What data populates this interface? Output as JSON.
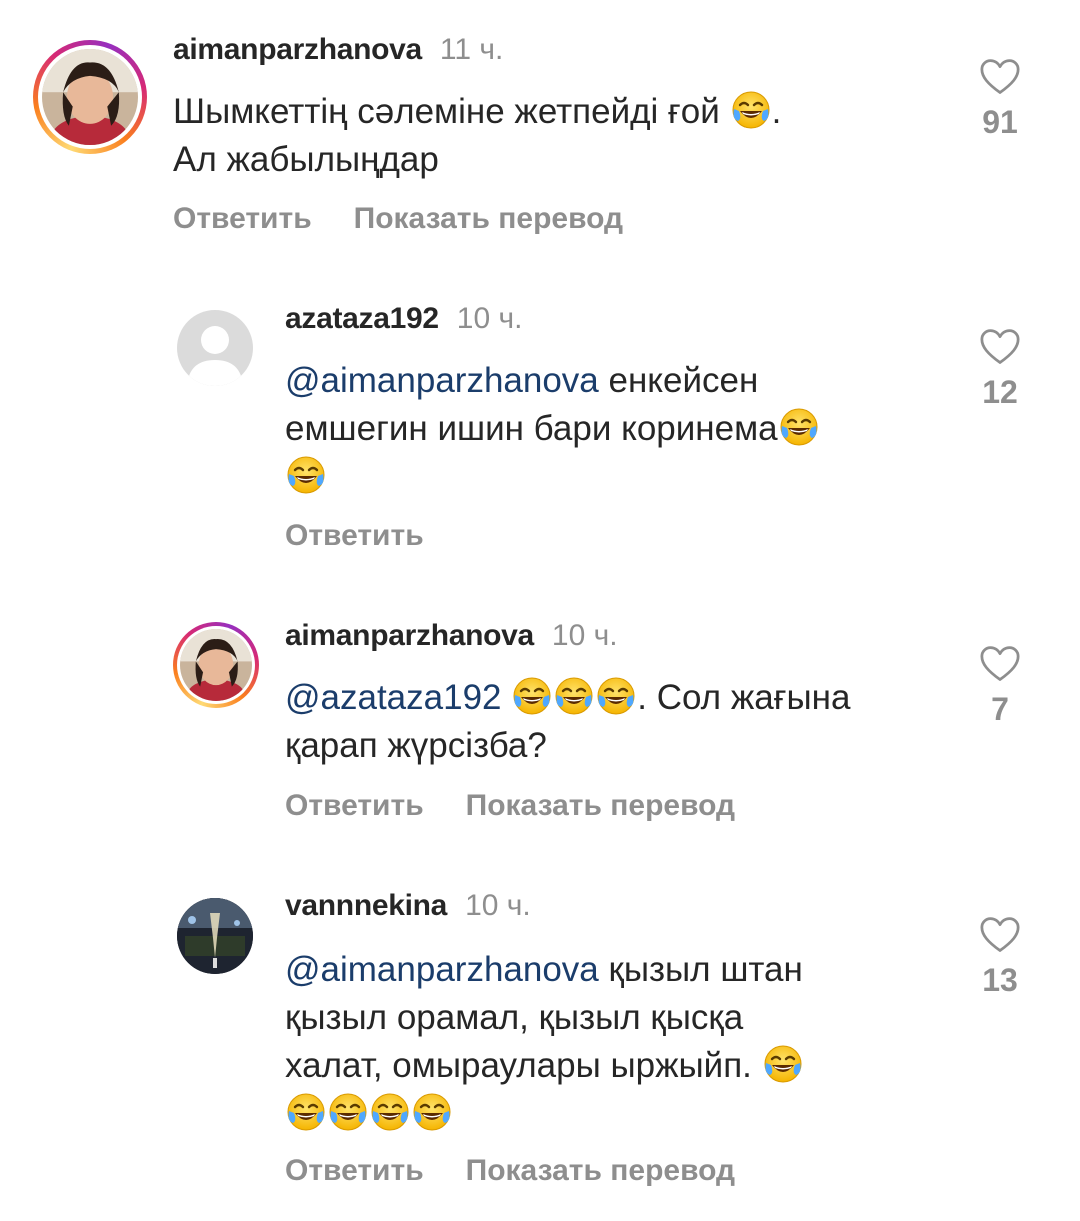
{
  "comments": [
    {
      "username": "aimanparzhanova",
      "time": "11 ч.",
      "text_line1": "Шымкеттің сәлеміне жетпейді ғой ",
      "text_line1_end": ".",
      "text_line2": "Ал жабылыңдар",
      "reply_label": "Ответить",
      "translate_label": "Показать перевод",
      "likes": "91"
    },
    {
      "username": "azataza192",
      "time": "10 ч.",
      "mention": "@aimanparzhanova",
      "text_line1": " енкейсен",
      "text_line2": "емшегин ишин бари коринема",
      "reply_label": "Ответить",
      "likes": "12"
    },
    {
      "username": "aimanparzhanova",
      "time": "10 ч.",
      "mention": "@azataza192",
      "text_line1_end": ". Сол жағына",
      "text_line2": "қарап жүрсізба?",
      "reply_label": "Ответить",
      "translate_label": "Показать перевод",
      "likes": "7"
    },
    {
      "username": "vannnekina",
      "time": "10 ч.",
      "mention": "@aimanparzhanova",
      "text_line1": " қызыл штан",
      "text_line2": "қызыл орамал, қызыл қысқа",
      "text_line3": "халат,  омыраулары ыржыйп. ",
      "reply_label": "Ответить",
      "translate_label": "Показать перевод",
      "likes": "13"
    }
  ],
  "icons": {
    "like": "heart-outline-icon",
    "emoji": "face-with-tears-of-joy"
  },
  "colors": {
    "mention": "#1b3d6b",
    "secondary_text": "#8e8e8e",
    "primary_text": "#262626"
  }
}
